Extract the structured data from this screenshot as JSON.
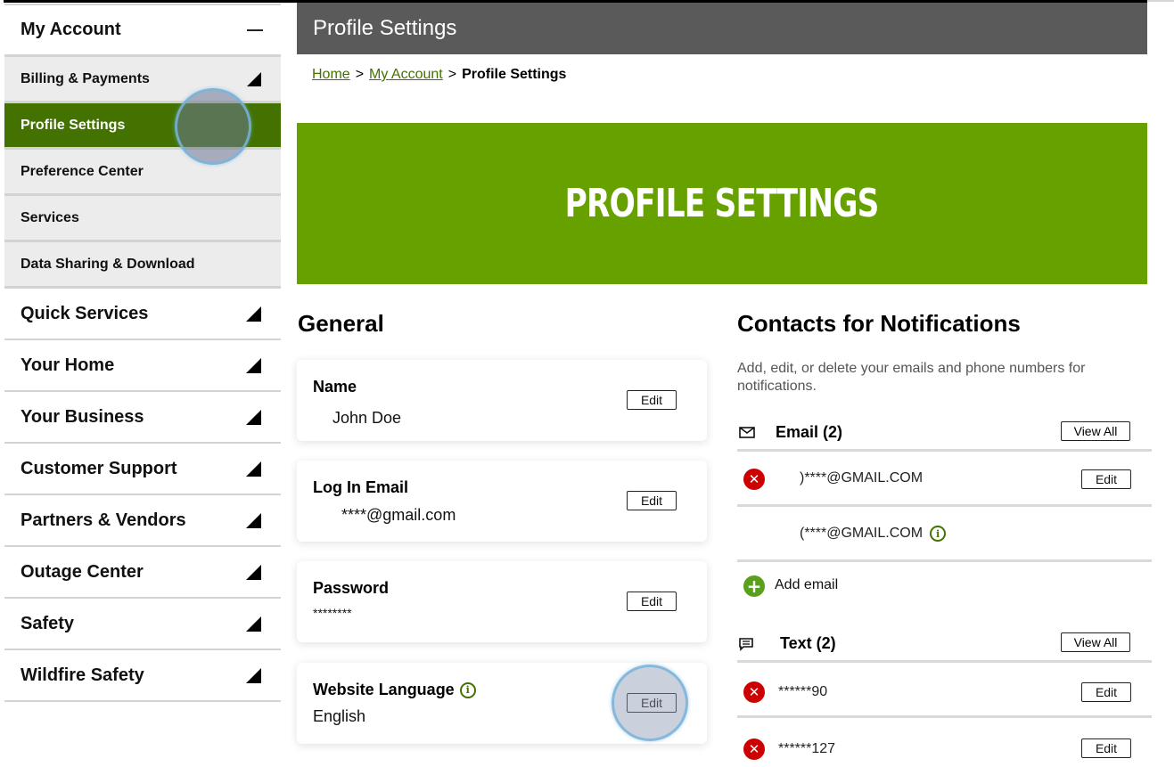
{
  "sidebar": {
    "header": {
      "label": "My Account",
      "icon": "minus-icon"
    },
    "sub_items": [
      {
        "label": "Billing & Payments",
        "expandable": true,
        "active": false
      },
      {
        "label": "Profile Settings",
        "expandable": false,
        "active": true
      },
      {
        "label": "Preference Center",
        "expandable": false,
        "active": false
      },
      {
        "label": "Services",
        "expandable": false,
        "active": false
      },
      {
        "label": "Data Sharing & Download",
        "expandable": false,
        "active": false
      }
    ],
    "main_items": [
      {
        "label": "Quick Services"
      },
      {
        "label": "Your Home"
      },
      {
        "label": "Your Business"
      },
      {
        "label": "Customer Support"
      },
      {
        "label": "Partners & Vendors"
      },
      {
        "label": "Outage Center"
      },
      {
        "label": "Safety"
      },
      {
        "label": "Wildfire Safety"
      }
    ]
  },
  "header": {
    "title": "Profile Settings"
  },
  "breadcrumb": {
    "items": [
      {
        "label": "Home",
        "link": true
      },
      {
        "label": "My Account",
        "link": true
      },
      {
        "label": "Profile Settings",
        "link": false
      }
    ],
    "separator": ">"
  },
  "banner": {
    "title": "PROFILE SETTINGS"
  },
  "general": {
    "title": "General",
    "cards": [
      {
        "label": "Name",
        "value": "John Doe",
        "edit_label": "Edit",
        "info": false
      },
      {
        "label": "Log In Email",
        "value": "****@gmail.com",
        "edit_label": "Edit",
        "info": false
      },
      {
        "label": "Password",
        "value": "********",
        "edit_label": "Edit",
        "info": false
      },
      {
        "label": "Website Language",
        "value": "English",
        "edit_label": "Edit",
        "info": true
      }
    ]
  },
  "contacts": {
    "title": "Contacts for Notifications",
    "description": "Add, edit, or delete your emails and phone numbers for notifications.",
    "email": {
      "label": "Email (2)",
      "icon": "envelope-icon",
      "view_all_label": "View All",
      "items": [
        {
          "value": ")****@GMAIL.COM",
          "deletable": true,
          "edit_label": "Edit",
          "info": false
        },
        {
          "value": "(****@GMAIL.COM",
          "deletable": false,
          "edit_label": null,
          "info": true
        }
      ],
      "add_label": "Add email"
    },
    "text": {
      "label": "Text (2)",
      "icon": "chat-icon",
      "view_all_label": "View All",
      "items": [
        {
          "value": "******90",
          "deletable": true,
          "edit_label": "Edit"
        },
        {
          "value": "******127",
          "deletable": true,
          "edit_label": "Edit"
        }
      ]
    }
  },
  "colors": {
    "active_nav": "#437200",
    "banner": "#66a100",
    "header_bar": "#5a5a5a",
    "delete_red": "#cc0000",
    "add_green": "#5aa01c",
    "link_green": "#437200"
  },
  "icons": {
    "x_glyph": "✕",
    "plus_glyph": "+",
    "info_glyph": "i"
  }
}
